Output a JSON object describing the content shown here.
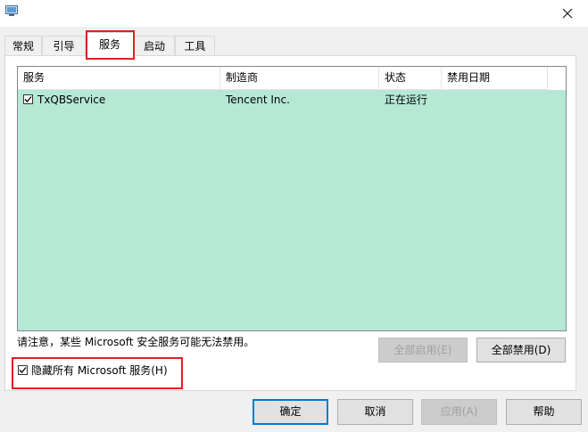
{
  "tabs": [
    {
      "label": "常规"
    },
    {
      "label": "引导"
    },
    {
      "label": "服务"
    },
    {
      "label": "启动"
    },
    {
      "label": "工具"
    }
  ],
  "active_tab": "服务",
  "services_list": {
    "columns": [
      "服务",
      "制造商",
      "状态",
      "禁用日期"
    ],
    "rows": [
      {
        "checked": true,
        "service": "TxQBService",
        "manufacturer": "Tencent Inc.",
        "status": "正在运行",
        "disabled_date": ""
      }
    ]
  },
  "note": "请注意，某些 Microsoft 安全服务可能无法禁用。",
  "buttons": {
    "enable_all": "全部启用(E)",
    "disable_all": "全部禁用(D)",
    "ok": "确定",
    "cancel": "取消",
    "apply": "应用(A)",
    "help": "帮助"
  },
  "hide_microsoft": {
    "checked": true,
    "label": "隐藏所有 Microsoft 服务(H)"
  },
  "colors": {
    "list_background": "#b5e8d5",
    "highlight": "#e02020",
    "default_button_border": "#0078d7"
  }
}
